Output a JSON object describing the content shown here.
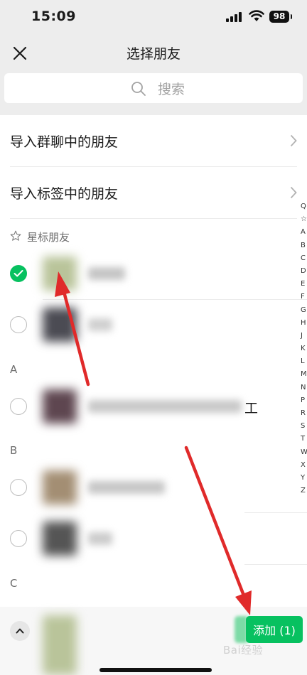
{
  "status_bar": {
    "time": "15:09",
    "battery": "98"
  },
  "nav": {
    "title": "选择朋友"
  },
  "search": {
    "placeholder": "搜索"
  },
  "import_rows": [
    {
      "label": "导入群聊中的朋友"
    },
    {
      "label": "导入标签中的朋友"
    }
  ],
  "sections": {
    "starred": "星标朋友",
    "a": "A",
    "b": "B",
    "c": "C"
  },
  "contacts": [
    {
      "section": "starred",
      "selected": true
    },
    {
      "section": "starred",
      "selected": false
    },
    {
      "section": "a",
      "selected": false,
      "visible_suffix": "工"
    },
    {
      "section": "b",
      "selected": false
    },
    {
      "section": "b",
      "selected": false
    }
  ],
  "index_letters": [
    "Q",
    "☆",
    "A",
    "B",
    "C",
    "D",
    "E",
    "F",
    "G",
    "H",
    "J",
    "K",
    "L",
    "M",
    "N",
    "P",
    "R",
    "S",
    "T",
    "W",
    "X",
    "Y",
    "Z"
  ],
  "bottom": {
    "add_label": "添加 (1)"
  },
  "watermark": "Bai经验",
  "colors": {
    "accent_green": "#07c160",
    "header_gray": "#ededed",
    "annotation_red": "#e02a2a"
  }
}
